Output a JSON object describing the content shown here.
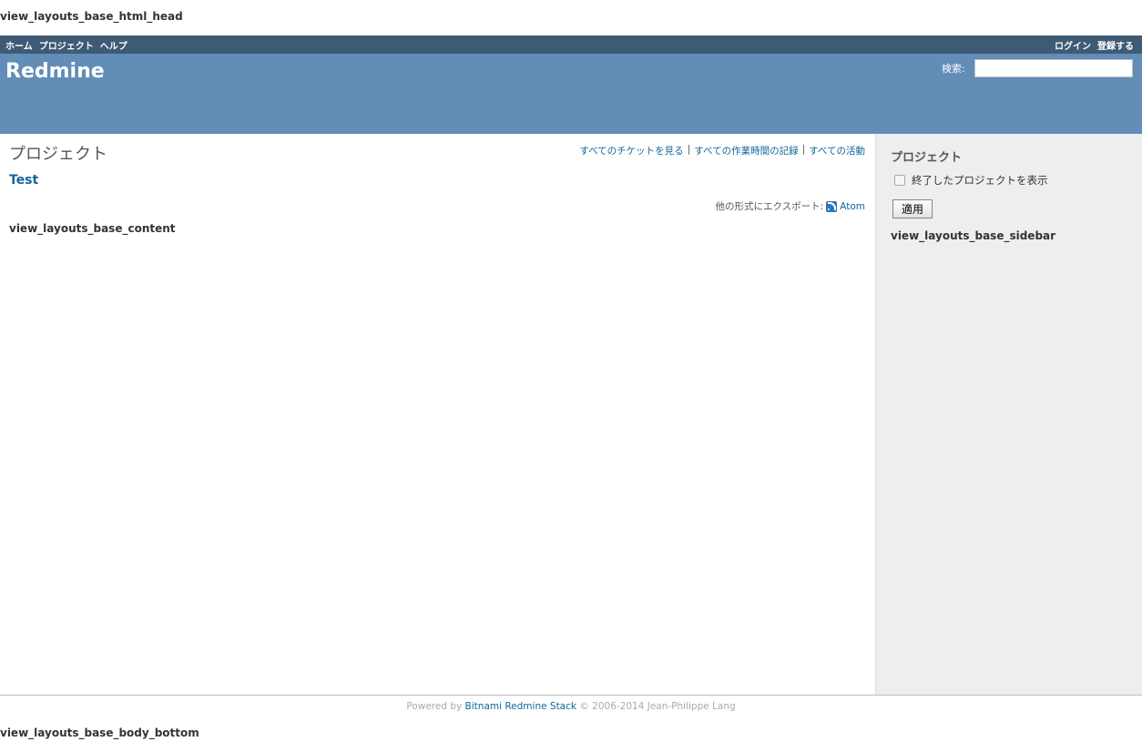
{
  "hooks": {
    "html_head": "view_layouts_base_html_head",
    "content": "view_layouts_base_content",
    "sidebar": "view_layouts_base_sidebar",
    "body_bottom": "view_layouts_base_body_bottom"
  },
  "top_menu": {
    "left": [
      "ホーム",
      "プロジェクト",
      "ヘルプ"
    ],
    "right": [
      "ログイン",
      "登録する"
    ]
  },
  "header": {
    "title": "Redmine",
    "search_label": "検索:",
    "search_value": ""
  },
  "main": {
    "title": "プロジェクト",
    "context_links": [
      "すべてのチケットを見る",
      "すべての作業時間の記録",
      "すべての活動"
    ],
    "separator": "|",
    "project": "Test",
    "export_label": "他の形式にエクスポート:",
    "export_atom": "Atom"
  },
  "sidebar": {
    "title": "プロジェクト",
    "closed_label": "終了したプロジェクトを表示",
    "apply": "適用"
  },
  "footer": {
    "powered_by": "Powered by",
    "link": "Bitnami Redmine Stack",
    "copyright": "© 2006-2014 Jean-Philippe Lang"
  },
  "colors": {
    "top_menu_bg": "#3e5b76",
    "header_bg": "#628db6",
    "sidebar_bg": "#eeeeee",
    "link": "#1166aa"
  }
}
